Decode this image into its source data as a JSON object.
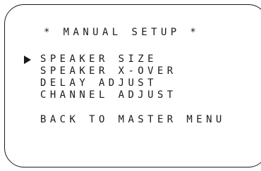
{
  "title": "* MANUAL SETUP *",
  "cursor_icon": "triangle-right-icon",
  "menu": {
    "items": [
      {
        "label": "SPEAKER SIZE",
        "selected": true
      },
      {
        "label": "SPEAKER X-OVER",
        "selected": false
      },
      {
        "label": "DELAY ADJUST",
        "selected": false
      },
      {
        "label": "CHANNEL ADJUST",
        "selected": false
      }
    ],
    "back_label": "BACK TO MASTER MENU"
  },
  "colors": {
    "text": "#1a1a1a",
    "background": "#ffffff"
  }
}
